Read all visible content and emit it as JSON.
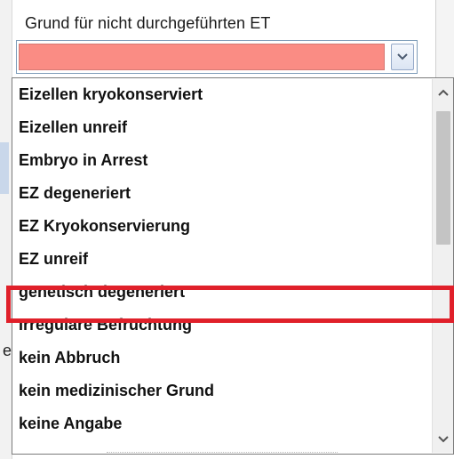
{
  "form": {
    "field_label": "Grund für nicht durchgeführten ET",
    "combo_value": "",
    "background_letter": "e"
  },
  "colors": {
    "combo_field_bg": "#fa8c84",
    "highlight_border": "#e0202a"
  },
  "dropdown": {
    "items": [
      {
        "label": "Eizellen kryokonserviert"
      },
      {
        "label": "Eizellen unreif"
      },
      {
        "label": "Embryo in Arrest"
      },
      {
        "label": "EZ degeneriert"
      },
      {
        "label": "EZ Kryokonservierung"
      },
      {
        "label": "EZ unreif"
      },
      {
        "label": "genetisch degeneriert"
      },
      {
        "label": "Irreguläre Befruchtung"
      },
      {
        "label": "kein Abbruch"
      },
      {
        "label": "kein medizinischer Grund"
      },
      {
        "label": "keine Angabe"
      }
    ],
    "highlighted_item": "genetisch degeneriert"
  },
  "icons": {
    "combo_dropdown": "chevron-down-icon",
    "scroll_up": "chevron-up-icon",
    "scroll_down": "chevron-down-icon"
  }
}
